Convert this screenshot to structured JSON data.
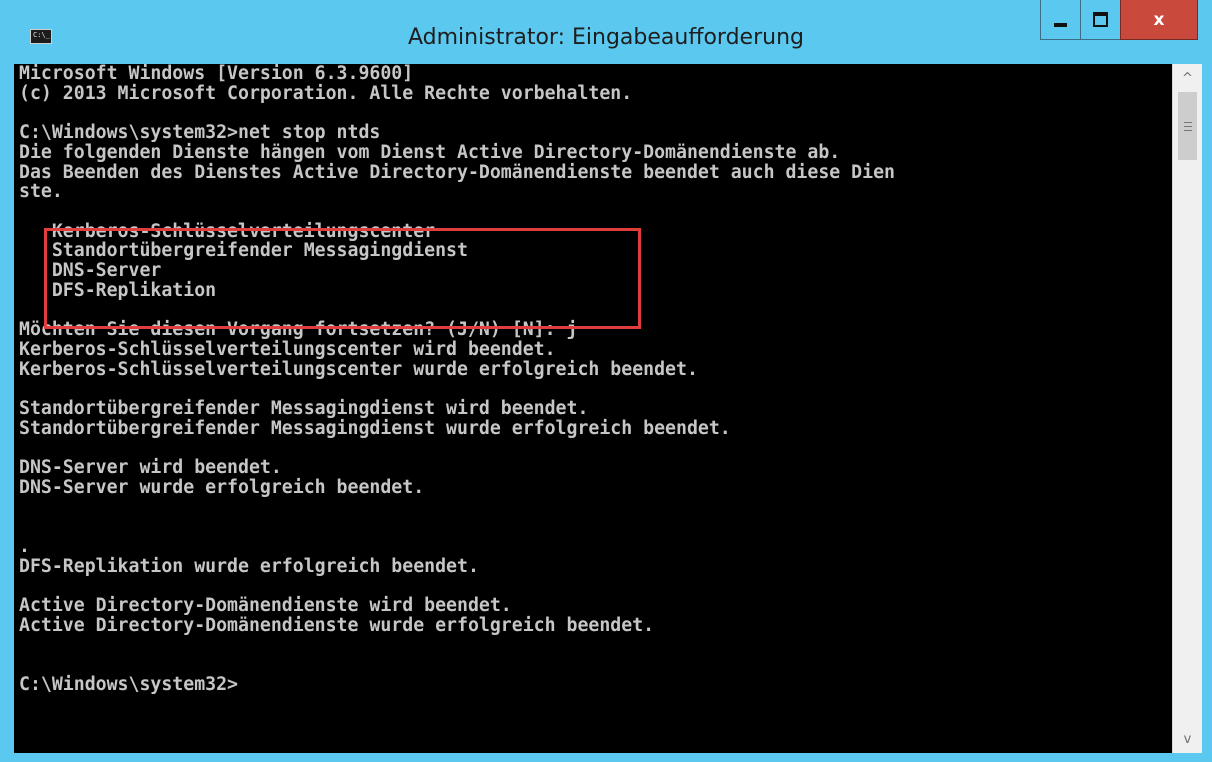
{
  "window": {
    "title": "Administrator: Eingabeaufforderung",
    "icon_label": "C:\\_",
    "colors": {
      "titlebar": "#5bc8f0",
      "close_button": "#c9493d",
      "console_background": "#000000",
      "console_text": "#c6c6c6",
      "highlight_border": "#e23d3d"
    },
    "buttons": {
      "minimize_icon": "minimize-icon",
      "maximize_icon": "maximize-icon",
      "close_label": "x"
    }
  },
  "console": {
    "lines": [
      "Microsoft Windows [Version 6.3.9600]",
      "(c) 2013 Microsoft Corporation. Alle Rechte vorbehalten.",
      "",
      "C:\\Windows\\system32>net stop ntds",
      "Die folgenden Dienste hängen vom Dienst Active Directory-Domänendienste ab.",
      "Das Beenden des Dienstes Active Directory-Domänendienste beendet auch diese Dien",
      "ste.",
      "",
      "   Kerberos-Schlüsselverteilungscenter",
      "   Standortübergreifender Messagingdienst",
      "   DNS-Server",
      "   DFS-Replikation",
      "",
      "Möchten Sie diesen Vorgang fortsetzen? (J/N) [N]: j",
      "Kerberos-Schlüsselverteilungscenter wird beendet.",
      "Kerberos-Schlüsselverteilungscenter wurde erfolgreich beendet.",
      "",
      "Standortübergreifender Messagingdienst wird beendet.",
      "Standortübergreifender Messagingdienst wurde erfolgreich beendet.",
      "",
      "DNS-Server wird beendet.",
      "DNS-Server wurde erfolgreich beendet.",
      "",
      "",
      ".",
      "DFS-Replikation wurde erfolgreich beendet.",
      "",
      "Active Directory-Domänendienste wird beendet.",
      "Active Directory-Domänendienste wurde erfolgreich beendet.",
      "",
      "",
      "C:\\Windows\\system32>"
    ]
  },
  "scrollbar": {
    "up_arrow": "^",
    "down_arrow": "v"
  }
}
